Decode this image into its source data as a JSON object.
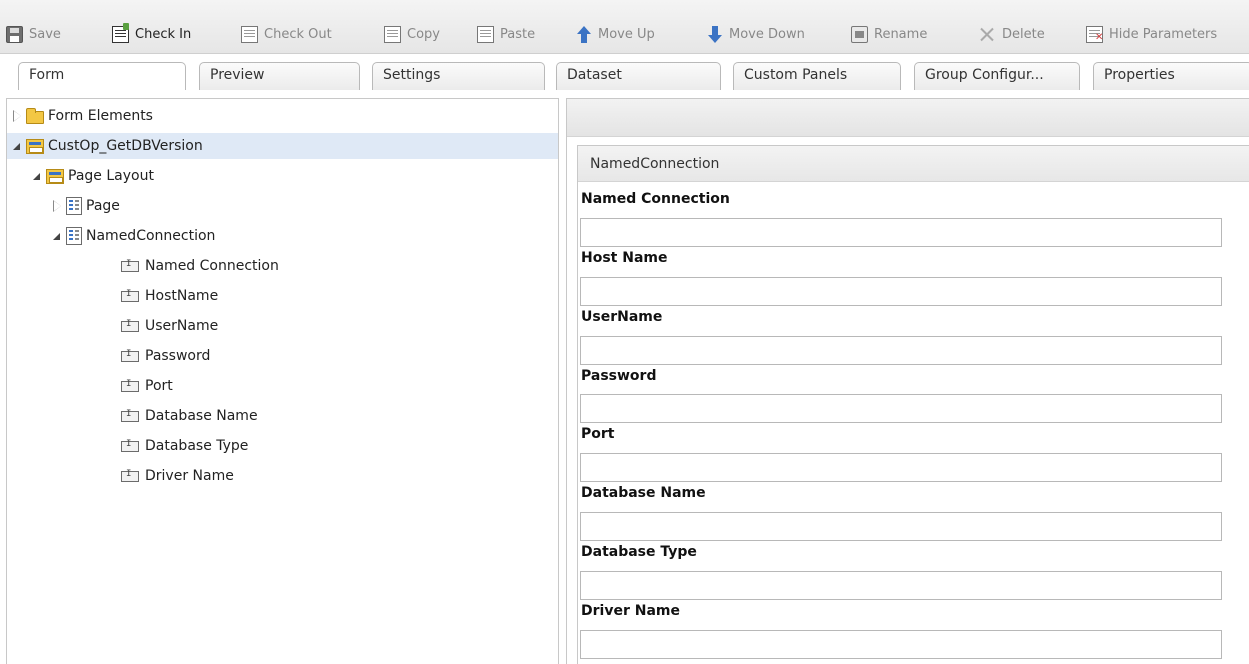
{
  "toolbar": {
    "save": "Save",
    "check_in": "Check In",
    "check_out": "Check Out",
    "copy": "Copy",
    "paste": "Paste",
    "move_up": "Move Up",
    "move_down": "Move Down",
    "rename": "Rename",
    "delete": "Delete",
    "hide_parameters": "Hide Parameters"
  },
  "left_tabs": [
    "Form",
    "Preview",
    "Settings"
  ],
  "right_tabs": [
    "Dataset",
    "Custom Panels",
    "Group Configur...",
    "Properties"
  ],
  "tree": {
    "form_elements": "Form Elements",
    "root": "CustOp_GetDBVersion",
    "page_layout": "Page Layout",
    "page": "Page",
    "named_connection": "NamedConnection",
    "fields": [
      "Named Connection",
      "HostName",
      "UserName",
      "Password",
      "Port",
      "Database Name",
      "Database Type",
      "Driver Name"
    ]
  },
  "panel": {
    "title": "NamedConnection",
    "fields": [
      {
        "label": "Named Connection",
        "value": ""
      },
      {
        "label": "Host Name",
        "value": ""
      },
      {
        "label": "UserName",
        "value": ""
      },
      {
        "label": "Password",
        "value": ""
      },
      {
        "label": "Port",
        "value": ""
      },
      {
        "label": "Database Name",
        "value": ""
      },
      {
        "label": "Database Type",
        "value": ""
      },
      {
        "label": "Driver Name",
        "value": ""
      }
    ]
  },
  "colors": {
    "selected_row": "#dfe9f6",
    "toolbar_bg": "#ececec",
    "accent_blue": "#3b73c4"
  }
}
